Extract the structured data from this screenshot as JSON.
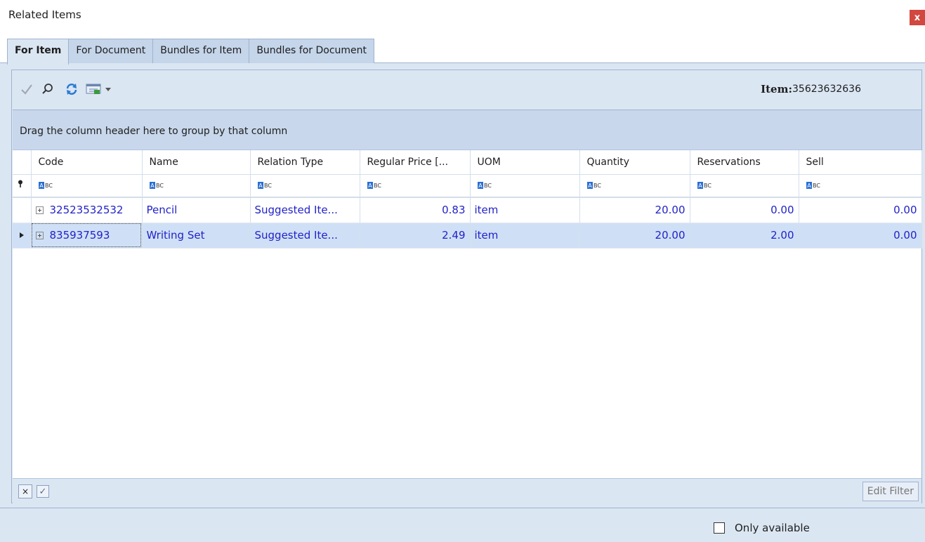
{
  "window": {
    "title": "Related Items",
    "close_label": "x"
  },
  "tabs": [
    {
      "label": "For Item",
      "active": true
    },
    {
      "label": "For Document",
      "active": false
    },
    {
      "label": "Bundles for Item",
      "active": false
    },
    {
      "label": "Bundles for Document",
      "active": false
    }
  ],
  "toolbar": {
    "item_label": "Item:",
    "item_value": "35623632636",
    "buttons": [
      "checkmark-icon",
      "search-icon",
      "refresh-icon",
      "export-icon",
      "dropdown-arrow-icon"
    ]
  },
  "grid": {
    "group_panel_text": "Drag the column header here to group by that column",
    "columns": [
      "Code",
      "Name",
      "Relation Type",
      "Regular Price [...",
      "UOM",
      "Quantity",
      "Reservations",
      "Sell"
    ],
    "rows": [
      {
        "code": "32523532532",
        "name": "Pencil",
        "relation_type": "Suggested Ite...",
        "regular_price": "0.83",
        "uom": "item",
        "quantity": "20.00",
        "reservations": "0.00",
        "sell": "0.00",
        "selected": false
      },
      {
        "code": "835937593",
        "name": "Writing Set",
        "relation_type": "Suggested Ite...",
        "regular_price": "2.49",
        "uom": "item",
        "quantity": "20.00",
        "reservations": "2.00",
        "sell": "0.00",
        "selected": true
      }
    ],
    "footer": {
      "edit_filter_label": "Edit Filter",
      "clear_label": "×",
      "check_label": "✓"
    }
  },
  "bottom": {
    "only_available_label": "Only available",
    "only_available_checked": false
  },
  "colors": {
    "accent": "#dbe6f3",
    "link": "#2222c8",
    "close": "#d2473f",
    "selection": "#cfe0f6"
  }
}
